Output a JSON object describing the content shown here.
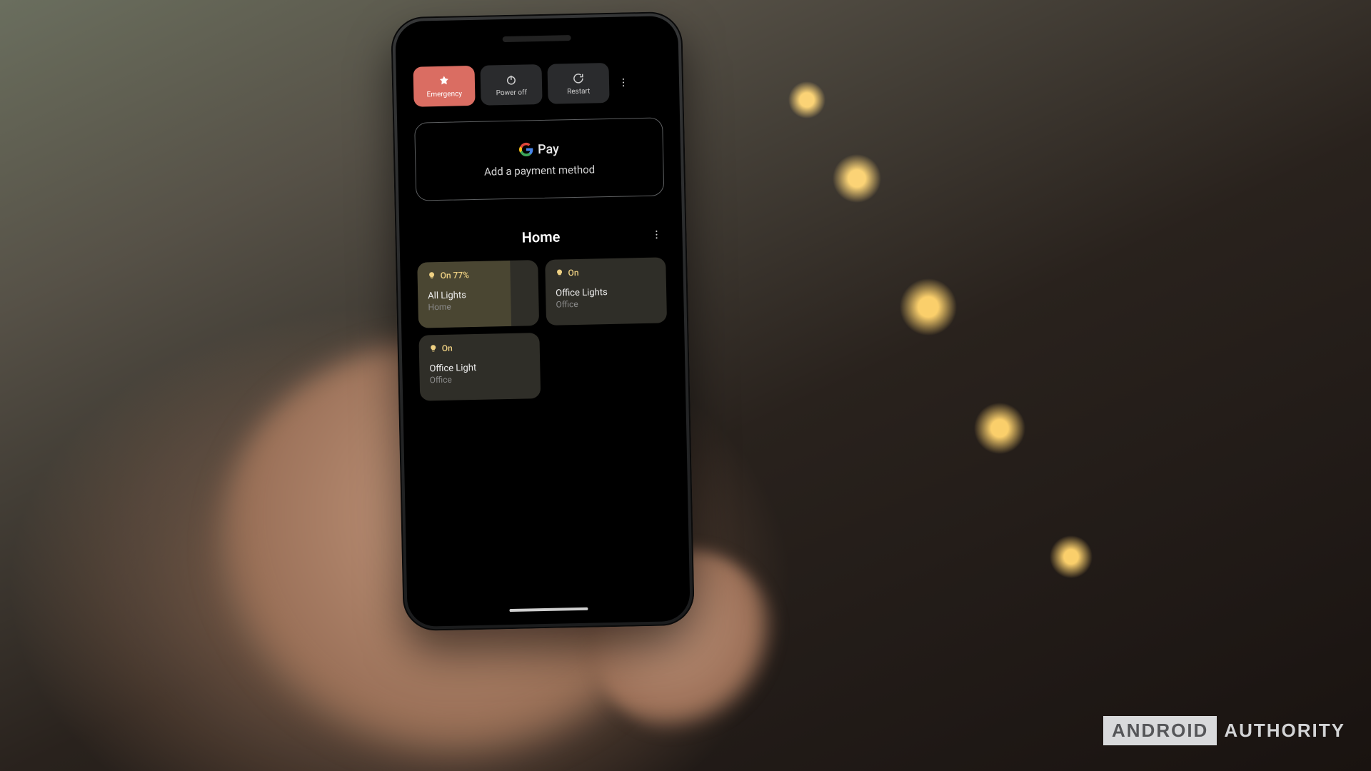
{
  "power": {
    "emergency": "Emergency",
    "poweroff": "Power off",
    "restart": "Restart"
  },
  "pay": {
    "brand": "Pay",
    "subtext": "Add a payment method"
  },
  "home": {
    "title": "Home",
    "tiles": [
      {
        "status": "On 77%",
        "name": "All Lights",
        "location": "Home"
      },
      {
        "status": "On",
        "name": "Office Lights",
        "location": "Office"
      },
      {
        "status": "On",
        "name": "Office Light",
        "location": "Office"
      }
    ]
  },
  "watermark": {
    "boxed": "ANDROID",
    "rest": "AUTHORITY"
  }
}
